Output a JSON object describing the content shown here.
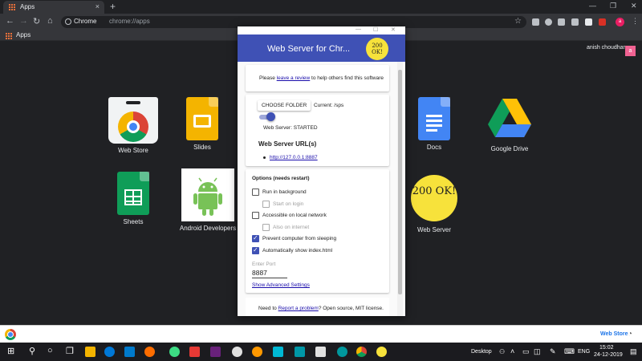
{
  "browser": {
    "tab_title": "Apps",
    "tab_close": "×",
    "new_tab": "+",
    "window_controls": [
      "—",
      "❐",
      "✕"
    ],
    "omnibox_label": "Chrome",
    "omnibox_url": "chrome://apps",
    "bookmark_label": "Apps",
    "profile_initial": "a"
  },
  "page": {
    "user_name": "anish choudhary",
    "user_initial": "a",
    "apps": [
      {
        "label": "Web Store"
      },
      {
        "label": "Slides"
      },
      {
        "label": "Docs"
      },
      {
        "label": "Google Drive"
      },
      {
        "label": "Sheets"
      },
      {
        "label": "Android Developers"
      },
      {
        "label": "Web Server"
      }
    ],
    "webserver_icon_text": "200 OK!"
  },
  "popup": {
    "window_controls": [
      "—",
      "☐",
      "✕"
    ],
    "title": "Web Server for Chr...",
    "logo_line1": "200",
    "logo_line2": "OK!",
    "review": {
      "pre": "Please ",
      "link": "leave a review",
      "post": " to help others find this software"
    },
    "choose_folder": "CHOOSE FOLDER",
    "current": "Current: /sps",
    "server_on": true,
    "status": "Web Server: STARTED",
    "url_heading": "Web Server URL(s)",
    "url": "http://127.0.0.1:8887",
    "options_heading": "Options (needs restart)",
    "options": [
      {
        "label": "Run in background",
        "checked": false,
        "dim": false
      },
      {
        "label": "Start on login",
        "checked": false,
        "dim": true
      },
      {
        "label": "Accessible on local network",
        "checked": false,
        "dim": false
      },
      {
        "label": "Also on internet",
        "checked": false,
        "dim": true
      },
      {
        "label": "Prevent computer from sleeping",
        "checked": true,
        "dim": false
      },
      {
        "label": "Automatically show index.html",
        "checked": true,
        "dim": false
      }
    ],
    "port_label": "Enter Port",
    "port_value": "8887",
    "advanced_link": "Show Advanced Settings",
    "footer": {
      "pre": "Need to ",
      "link": "Report a problem",
      "post": "? Open source, MIT license."
    }
  },
  "notification_bar": {
    "label": "Web Store"
  },
  "taskbar": {
    "desktop_label": "Desktop",
    "language": "ENG",
    "time": "15:02",
    "date": "24-12-2019"
  },
  "colors": {
    "popup_header": "#3f51b5",
    "chrome_dark": "#202124",
    "accent_yellow": "#f7e23b"
  }
}
